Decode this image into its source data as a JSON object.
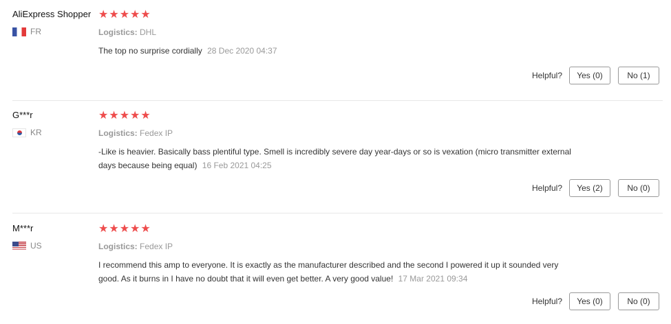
{
  "reviews": [
    {
      "name": "AliExpress Shopper",
      "country": "FR",
      "flag_icon": "flag-fr-icon",
      "stars": 5,
      "logistics_label": "Logistics:",
      "logistics": "DHL",
      "text": "The top no surprise cordially",
      "date": "28 Dec 2020 04:37",
      "helpful_label": "Helpful?",
      "yes_label": "Yes (0)",
      "no_label": "No (1)"
    },
    {
      "name": "G***r",
      "country": "KR",
      "flag_icon": "flag-kr-icon",
      "stars": 5,
      "logistics_label": "Logistics:",
      "logistics": "Fedex IP",
      "text": "-Like is heavier. Basically bass plentiful type. Smell is incredibly severe day year-days or so is vexation (micro transmitter external days because being equal)",
      "date": "16 Feb 2021 04:25",
      "helpful_label": "Helpful?",
      "yes_label": "Yes (2)",
      "no_label": "No (0)"
    },
    {
      "name": "M***r",
      "country": "US",
      "flag_icon": "flag-us-icon",
      "stars": 5,
      "logistics_label": "Logistics:",
      "logistics": "Fedex IP",
      "text": "I recommend this amp to everyone. It is exactly as the manufacturer described and the second I powered it up it sounded very good. As it burns in I have no doubt that it will even get better. A very good value!",
      "date": "17 Mar 2021 09:34",
      "helpful_label": "Helpful?",
      "yes_label": "Yes (0)",
      "no_label": "No (0)"
    }
  ],
  "colors": {
    "star": "#ee4d4d",
    "muted": "#999999",
    "button_border": "#999999",
    "divider": "#e8e8e8"
  }
}
